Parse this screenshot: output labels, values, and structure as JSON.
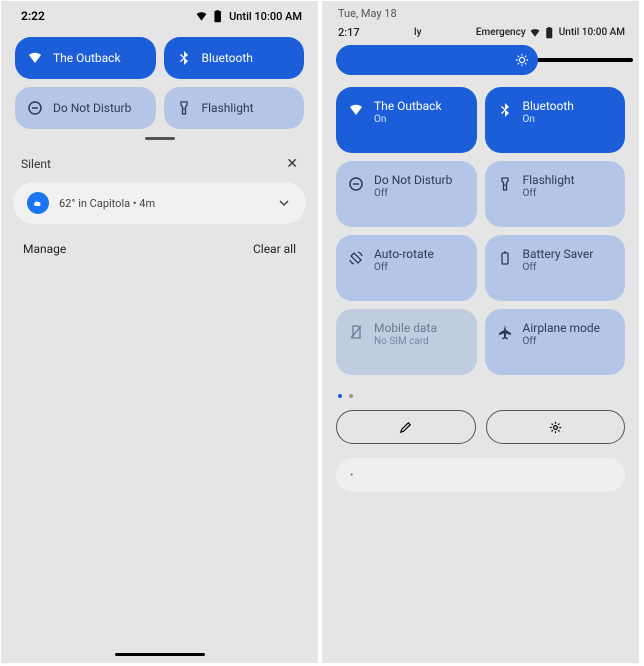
{
  "left": {
    "status": {
      "time": "2:22",
      "battery_text": "Until 10:00 AM"
    },
    "tiles": [
      [
        {
          "name": "wifi-tile",
          "icon": "wifi",
          "label": "The Outback",
          "active": true
        },
        {
          "name": "bluetooth-tile",
          "icon": "bluetooth",
          "label": "Bluetooth",
          "active": true
        }
      ],
      [
        {
          "name": "dnd-tile",
          "icon": "dnd",
          "label": "Do Not Disturb",
          "active": false
        },
        {
          "name": "flashlight-tile",
          "icon": "flashlight",
          "label": "Flashlight",
          "active": false
        }
      ]
    ],
    "section_title": "Silent",
    "notif": {
      "text": "62° in Capitola • 4m"
    },
    "actions": {
      "manage": "Manage",
      "clear": "Clear all"
    }
  },
  "right": {
    "date": "Tue, May 18",
    "status": {
      "time": "2:17",
      "carrier": "ly",
      "emergency": "Emergency",
      "battery_text": "Until 10:00 AM"
    },
    "brightness_pct": 70,
    "tiles": [
      [
        {
          "name": "wifi-tile",
          "icon": "wifi",
          "label": "The Outback",
          "sub": "On",
          "state": "on"
        },
        {
          "name": "bluetooth-tile",
          "icon": "bluetooth",
          "label": "Bluetooth",
          "sub": "On",
          "state": "on"
        }
      ],
      [
        {
          "name": "dnd-tile",
          "icon": "dnd",
          "label": "Do Not Disturb",
          "sub": "Off",
          "state": "off"
        },
        {
          "name": "flashlight-tile",
          "icon": "flashlight",
          "label": "Flashlight",
          "sub": "Off",
          "state": "off"
        }
      ],
      [
        {
          "name": "autorotate-tile",
          "icon": "rotate",
          "label": "Auto-rotate",
          "sub": "Off",
          "state": "off"
        },
        {
          "name": "batterysaver-tile",
          "icon": "battery",
          "label": "Battery Saver",
          "sub": "Off",
          "state": "off"
        }
      ],
      [
        {
          "name": "mobiledata-tile",
          "icon": "sim",
          "label": "Mobile data",
          "sub": "No SIM card",
          "state": "disabled"
        },
        {
          "name": "airplane-tile",
          "icon": "airplane",
          "label": "Airplane mode",
          "sub": "Off",
          "state": "off"
        }
      ]
    ],
    "notif_placeholder": "•"
  },
  "icons": {
    "wifi": "wifi-icon",
    "bluetooth": "bluetooth-icon",
    "dnd": "dnd-icon",
    "flashlight": "flashlight-icon",
    "rotate": "rotate-icon",
    "battery": "battery-icon",
    "sim": "sim-icon",
    "airplane": "airplane-icon"
  }
}
